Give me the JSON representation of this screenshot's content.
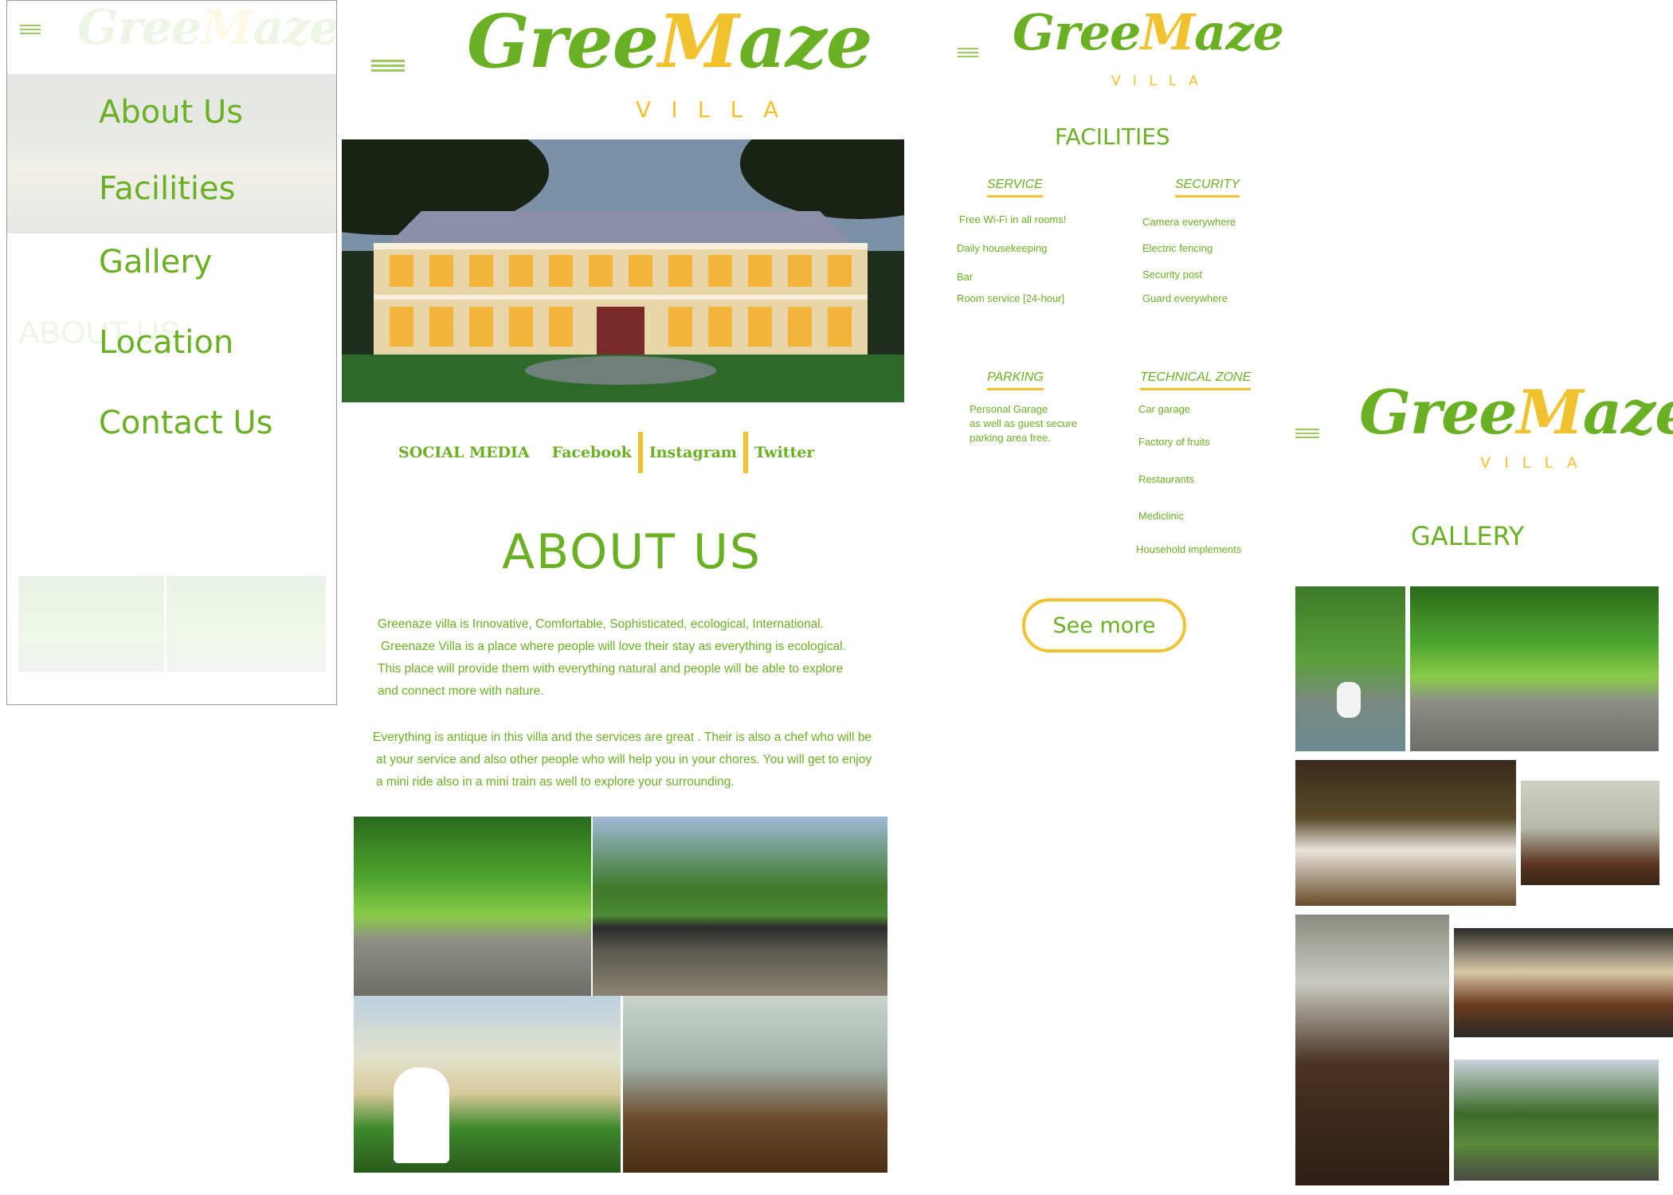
{
  "brand": {
    "name_part1": "Gree",
    "name_m": "M",
    "name_part2": "aze",
    "sub": "VILLA"
  },
  "menu": {
    "items": [
      "About Us",
      "Facilities",
      "Gallery",
      "Location",
      "Contact Us"
    ]
  },
  "home": {
    "social": {
      "label": "SOCIAL MEDIA",
      "facebook": "Facebook",
      "instagram": "Instagram",
      "twitter": "Twitter"
    },
    "about_title": "ABOUT US",
    "about_lines_1": [
      "Greenaze villa is Innovative, Comfortable, Sophisticated, ecological, International.",
      "Greenaze Villa is a place where people will love their stay as everything is ecological.",
      "This place will provide them with everything natural and people will be able to explore",
      "and connect  more with nature."
    ],
    "about_lines_2": [
      "Everything is antique in this villa and the services are great . Their is also a chef who will be",
      "at your service and also other people who will help you in your chores.  You will get to enjoy",
      "a mini ride also in a mini train as well to explore your surrounding."
    ]
  },
  "facilities": {
    "title": "FACILITIES",
    "service": {
      "heading": "SERVICE",
      "items": [
        "Free Wi-Fi in all rooms!",
        "Daily housekeeping",
        "Bar",
        "Room service [24-hour]"
      ]
    },
    "security": {
      "heading": "SECURITY",
      "items": [
        "Camera everywhere",
        "Electric fencing",
        "Security post",
        "Guard everywhere"
      ]
    },
    "parking": {
      "heading": "PARKING",
      "text": [
        "Personal Garage",
        "as well as guest secure",
        "parking area free."
      ]
    },
    "technical": {
      "heading": "TECHNICAL ZONE",
      "items": [
        "Car garage",
        "Factory of fruits",
        "Restaurants",
        "Mediclinic",
        "Household implements"
      ]
    },
    "see_more": "See more"
  },
  "gallery": {
    "title": "GALLERY"
  },
  "colors": {
    "green": "#6ab023",
    "yellow": "#f2c12e"
  },
  "icons": {
    "menu": "hamburger-icon"
  }
}
